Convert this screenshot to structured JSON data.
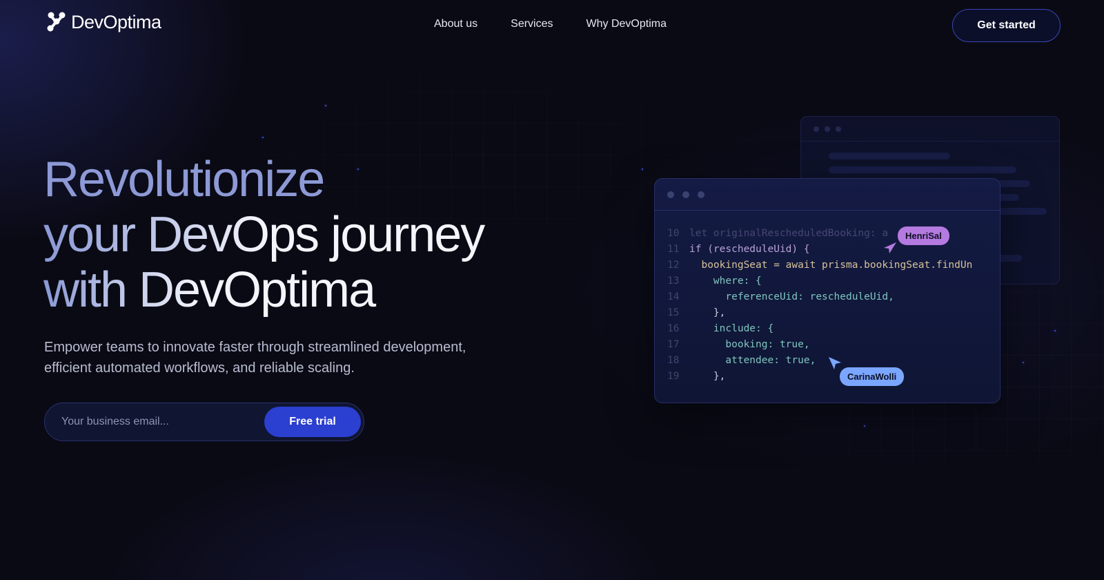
{
  "brand": {
    "name": "DevOptima"
  },
  "nav": {
    "items": [
      {
        "label": "About us"
      },
      {
        "label": "Services"
      },
      {
        "label": "Why DevOptima"
      }
    ]
  },
  "header": {
    "cta_label": "Get started"
  },
  "hero": {
    "title_lines": [
      "Revolutionize",
      "your DevOps journey",
      "with DevOptima"
    ],
    "subtitle_lines": [
      "Empower teams to innovate faster through streamlined development,",
      "efficient automated workflows, and reliable scaling."
    ]
  },
  "signup": {
    "email_placeholder": "Your business email...",
    "button_label": "Free trial"
  },
  "code_window": {
    "lines": [
      {
        "num": "10",
        "text": "let originalRescheduledBooking: a"
      },
      {
        "num": "11",
        "text": "if (rescheduleUid) {"
      },
      {
        "num": "12",
        "text": "  bookingSeat = await prisma.bookingSeat.findUn"
      },
      {
        "num": "13",
        "text": "    where: {"
      },
      {
        "num": "14",
        "text": "      referenceUid: rescheduleUid,"
      },
      {
        "num": "15",
        "text": "    },"
      },
      {
        "num": "16",
        "text": "    include: {"
      },
      {
        "num": "17",
        "text": "      booking: true,"
      },
      {
        "num": "18",
        "text": "      attendee: true,"
      },
      {
        "num": "19",
        "text": "    },"
      }
    ],
    "collaborators": [
      {
        "name": "HenriSal",
        "color": "#b47ae0"
      },
      {
        "name": "CarinaWolli",
        "color": "#7aa6ff"
      }
    ]
  },
  "colors": {
    "background": "#0a0a14",
    "accent": "#2b3fd0",
    "title_gradient_start": "#8d9ad6",
    "title_gradient_end": "#f4f5fb"
  },
  "icons": [
    "devoptima-logo-icon",
    "cursor-arrow-icon"
  ]
}
